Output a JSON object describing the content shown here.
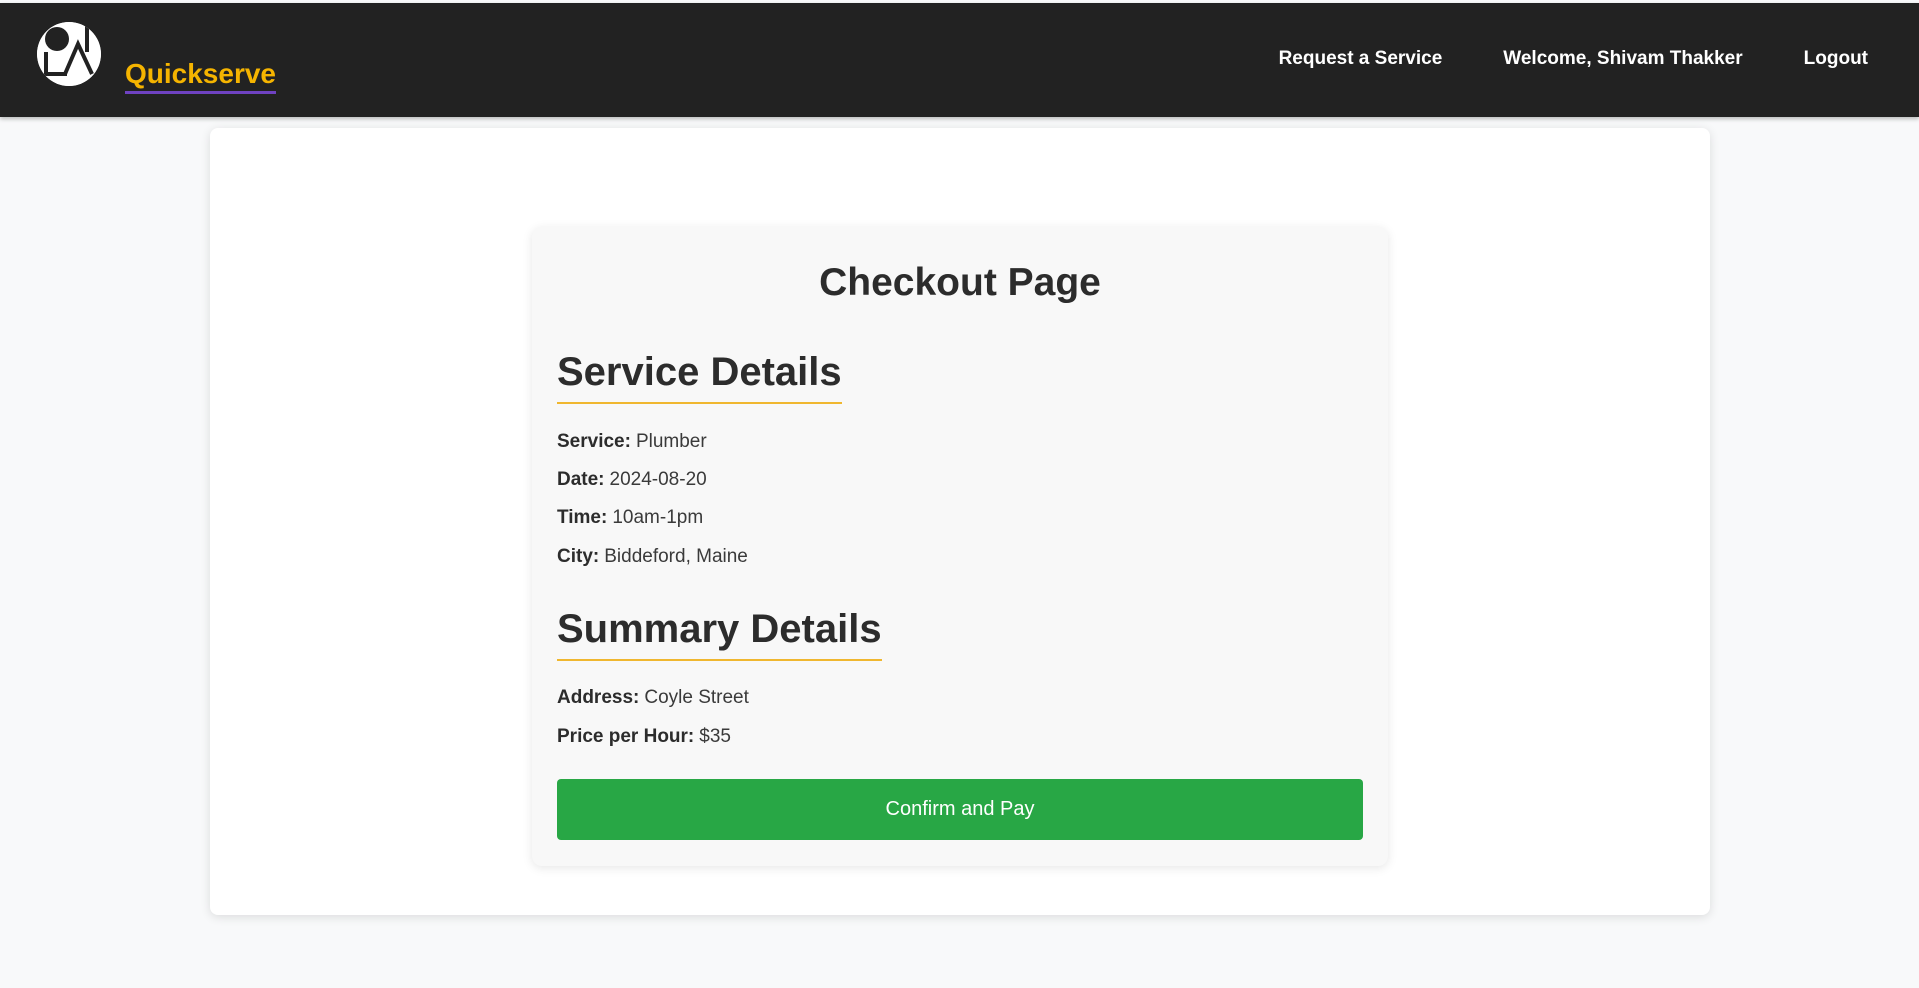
{
  "navbar": {
    "brand_name": "Quickserve",
    "logo_icon": "quickserve-logo-icon",
    "links": [
      {
        "label": "Request a Service"
      },
      {
        "label": "Welcome, Shivam Thakker"
      },
      {
        "label": "Logout"
      }
    ]
  },
  "checkout": {
    "title": "Checkout Page",
    "service_section": {
      "heading": "Service Details",
      "rows": [
        {
          "label": "Service:",
          "value": "Plumber"
        },
        {
          "label": "Date:",
          "value": "2024-08-20"
        },
        {
          "label": "Time:",
          "value": "10am-1pm"
        },
        {
          "label": "City:",
          "value": "Biddeford, Maine"
        }
      ]
    },
    "summary_section": {
      "heading": "Summary Details",
      "rows": [
        {
          "label": "Address:",
          "value": "Coyle Street"
        },
        {
          "label": "Price per Hour:",
          "value": "$35"
        }
      ]
    },
    "confirm_button": "Confirm and Pay"
  },
  "colors": {
    "navbar_bg": "#222222",
    "brand": "#f5b400",
    "brand_underline": "#6f42c1",
    "heading_underline": "#f0b72f",
    "button": "#28a745"
  }
}
